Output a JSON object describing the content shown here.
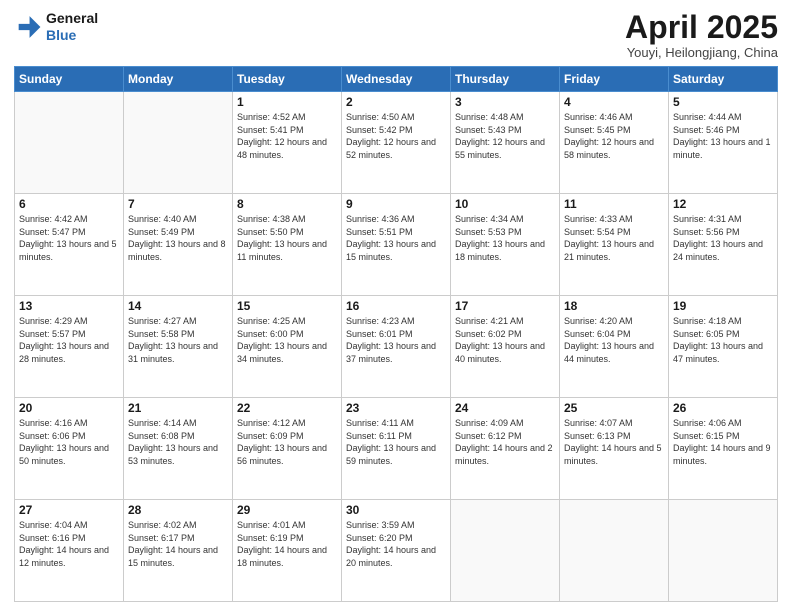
{
  "logo": {
    "line1": "General",
    "line2": "Blue"
  },
  "header": {
    "title": "April 2025",
    "location": "Youyi, Heilongjiang, China"
  },
  "weekdays": [
    "Sunday",
    "Monday",
    "Tuesday",
    "Wednesday",
    "Thursday",
    "Friday",
    "Saturday"
  ],
  "weeks": [
    [
      {
        "day": "",
        "info": ""
      },
      {
        "day": "",
        "info": ""
      },
      {
        "day": "1",
        "info": "Sunrise: 4:52 AM\nSunset: 5:41 PM\nDaylight: 12 hours and 48 minutes."
      },
      {
        "day": "2",
        "info": "Sunrise: 4:50 AM\nSunset: 5:42 PM\nDaylight: 12 hours and 52 minutes."
      },
      {
        "day": "3",
        "info": "Sunrise: 4:48 AM\nSunset: 5:43 PM\nDaylight: 12 hours and 55 minutes."
      },
      {
        "day": "4",
        "info": "Sunrise: 4:46 AM\nSunset: 5:45 PM\nDaylight: 12 hours and 58 minutes."
      },
      {
        "day": "5",
        "info": "Sunrise: 4:44 AM\nSunset: 5:46 PM\nDaylight: 13 hours and 1 minute."
      }
    ],
    [
      {
        "day": "6",
        "info": "Sunrise: 4:42 AM\nSunset: 5:47 PM\nDaylight: 13 hours and 5 minutes."
      },
      {
        "day": "7",
        "info": "Sunrise: 4:40 AM\nSunset: 5:49 PM\nDaylight: 13 hours and 8 minutes."
      },
      {
        "day": "8",
        "info": "Sunrise: 4:38 AM\nSunset: 5:50 PM\nDaylight: 13 hours and 11 minutes."
      },
      {
        "day": "9",
        "info": "Sunrise: 4:36 AM\nSunset: 5:51 PM\nDaylight: 13 hours and 15 minutes."
      },
      {
        "day": "10",
        "info": "Sunrise: 4:34 AM\nSunset: 5:53 PM\nDaylight: 13 hours and 18 minutes."
      },
      {
        "day": "11",
        "info": "Sunrise: 4:33 AM\nSunset: 5:54 PM\nDaylight: 13 hours and 21 minutes."
      },
      {
        "day": "12",
        "info": "Sunrise: 4:31 AM\nSunset: 5:56 PM\nDaylight: 13 hours and 24 minutes."
      }
    ],
    [
      {
        "day": "13",
        "info": "Sunrise: 4:29 AM\nSunset: 5:57 PM\nDaylight: 13 hours and 28 minutes."
      },
      {
        "day": "14",
        "info": "Sunrise: 4:27 AM\nSunset: 5:58 PM\nDaylight: 13 hours and 31 minutes."
      },
      {
        "day": "15",
        "info": "Sunrise: 4:25 AM\nSunset: 6:00 PM\nDaylight: 13 hours and 34 minutes."
      },
      {
        "day": "16",
        "info": "Sunrise: 4:23 AM\nSunset: 6:01 PM\nDaylight: 13 hours and 37 minutes."
      },
      {
        "day": "17",
        "info": "Sunrise: 4:21 AM\nSunset: 6:02 PM\nDaylight: 13 hours and 40 minutes."
      },
      {
        "day": "18",
        "info": "Sunrise: 4:20 AM\nSunset: 6:04 PM\nDaylight: 13 hours and 44 minutes."
      },
      {
        "day": "19",
        "info": "Sunrise: 4:18 AM\nSunset: 6:05 PM\nDaylight: 13 hours and 47 minutes."
      }
    ],
    [
      {
        "day": "20",
        "info": "Sunrise: 4:16 AM\nSunset: 6:06 PM\nDaylight: 13 hours and 50 minutes."
      },
      {
        "day": "21",
        "info": "Sunrise: 4:14 AM\nSunset: 6:08 PM\nDaylight: 13 hours and 53 minutes."
      },
      {
        "day": "22",
        "info": "Sunrise: 4:12 AM\nSunset: 6:09 PM\nDaylight: 13 hours and 56 minutes."
      },
      {
        "day": "23",
        "info": "Sunrise: 4:11 AM\nSunset: 6:11 PM\nDaylight: 13 hours and 59 minutes."
      },
      {
        "day": "24",
        "info": "Sunrise: 4:09 AM\nSunset: 6:12 PM\nDaylight: 14 hours and 2 minutes."
      },
      {
        "day": "25",
        "info": "Sunrise: 4:07 AM\nSunset: 6:13 PM\nDaylight: 14 hours and 5 minutes."
      },
      {
        "day": "26",
        "info": "Sunrise: 4:06 AM\nSunset: 6:15 PM\nDaylight: 14 hours and 9 minutes."
      }
    ],
    [
      {
        "day": "27",
        "info": "Sunrise: 4:04 AM\nSunset: 6:16 PM\nDaylight: 14 hours and 12 minutes."
      },
      {
        "day": "28",
        "info": "Sunrise: 4:02 AM\nSunset: 6:17 PM\nDaylight: 14 hours and 15 minutes."
      },
      {
        "day": "29",
        "info": "Sunrise: 4:01 AM\nSunset: 6:19 PM\nDaylight: 14 hours and 18 minutes."
      },
      {
        "day": "30",
        "info": "Sunrise: 3:59 AM\nSunset: 6:20 PM\nDaylight: 14 hours and 20 minutes."
      },
      {
        "day": "",
        "info": ""
      },
      {
        "day": "",
        "info": ""
      },
      {
        "day": "",
        "info": ""
      }
    ]
  ]
}
